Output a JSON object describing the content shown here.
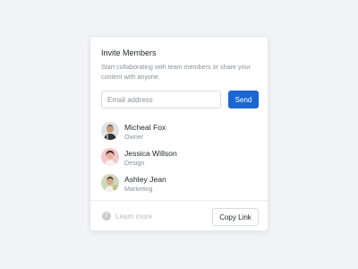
{
  "dialog": {
    "title": "Invite Members",
    "subtitle": "Start collaborating with team members or share your content with anyone."
  },
  "invite_form": {
    "email_placeholder": "Email address",
    "email_value": "",
    "send_label": "Send"
  },
  "members": [
    {
      "name": "Micheal Fox",
      "role": "Owner",
      "avatar_icon": "avatar-photo-man"
    },
    {
      "name": "Jessica Willson",
      "role": "Design",
      "avatar_icon": "avatar-photo-woman"
    },
    {
      "name": "Ashley Jean",
      "role": "Marketing",
      "avatar_icon": "avatar-photo-man-2"
    }
  ],
  "footer": {
    "learn_more_label": "Learn more",
    "learn_more_icon": "info-icon",
    "copy_link_label": "Copy Link"
  },
  "colors": {
    "accent": "#1a67d2",
    "background": "#f2f3f4",
    "card": "#ffffff",
    "muted_text": "#8a9099"
  }
}
